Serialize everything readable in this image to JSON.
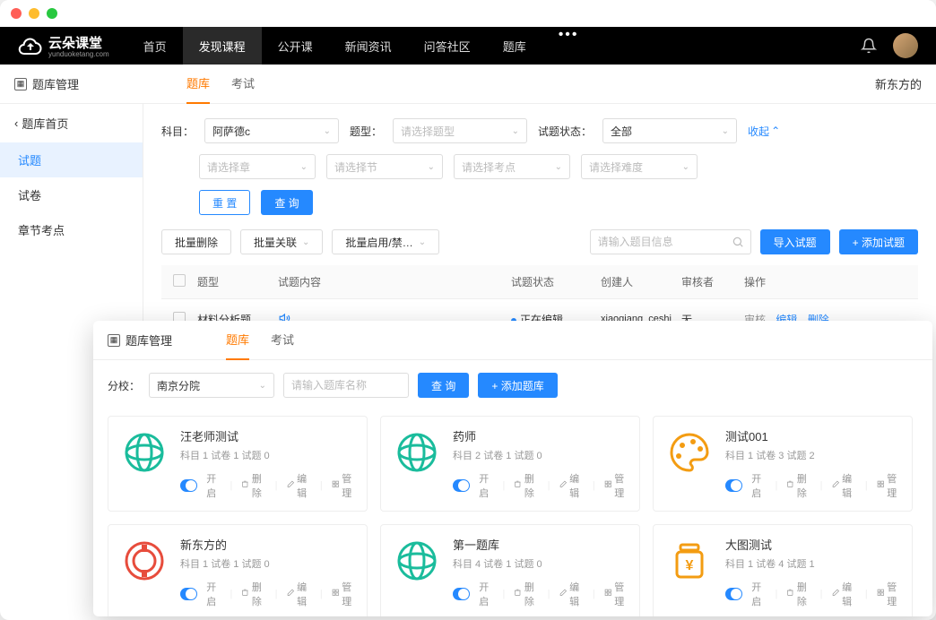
{
  "topnav": {
    "logo_text": "云朵课堂",
    "logo_sub": "yunduoketang.com",
    "items": [
      "首页",
      "发现课程",
      "公开课",
      "新闻资讯",
      "问答社区",
      "题库"
    ],
    "active_index": 1
  },
  "subheader": {
    "title": "题库管理",
    "tabs": [
      "题库",
      "考试"
    ],
    "active_tab": 0,
    "right_text": "新东方的"
  },
  "sidebar": {
    "back": "题库首页",
    "items": [
      "试题",
      "试卷",
      "章节考点"
    ],
    "active_index": 0
  },
  "filters": {
    "subject_label": "科目：",
    "subject_value": "阿萨德c",
    "type_label": "题型：",
    "type_placeholder": "请选择题型",
    "status_label": "试题状态：",
    "status_value": "全部",
    "collapse": "收起",
    "chapter_placeholder": "请选择章",
    "section_placeholder": "请选择节",
    "point_placeholder": "请选择考点",
    "difficulty_placeholder": "请选择难度",
    "reset_btn": "重 置",
    "query_btn": "查 询"
  },
  "actions": {
    "batch_delete": "批量删除",
    "batch_link": "批量关联",
    "batch_enable": "批量启用/禁…",
    "search_placeholder": "请输入题目信息",
    "import_btn": "导入试题",
    "add_btn": "+ 添加试题"
  },
  "table": {
    "headers": {
      "type": "题型",
      "content": "试题内容",
      "status": "试题状态",
      "creator": "创建人",
      "reviewer": "审核者",
      "ops": "操作"
    },
    "rows": [
      {
        "type": "材料分析题",
        "content_icon": "audio",
        "status": "正在编辑",
        "creator": "xiaoqiang_ceshi",
        "reviewer": "无",
        "ops": {
          "review": "审核",
          "edit": "编辑",
          "delete": "删除"
        }
      }
    ]
  },
  "overlay": {
    "title": "题库管理",
    "tabs": [
      "题库",
      "考试"
    ],
    "active_tab": 0,
    "branch_label": "分校：",
    "branch_value": "南京分院",
    "name_placeholder": "请输入题库名称",
    "query_btn": "查 询",
    "add_btn": "+ 添加题库",
    "card_ops": {
      "open": "开启",
      "delete": "删除",
      "edit": "编辑",
      "manage": "管理"
    },
    "cards": [
      {
        "title": "汪老师测试",
        "meta": "科目 1  试卷 1  试题 0",
        "icon": "globe-green"
      },
      {
        "title": "药师",
        "meta": "科目 2  试卷 1  试题 0",
        "icon": "globe-green"
      },
      {
        "title": "测试001",
        "meta": "科目 1  试卷 3  试题 2",
        "icon": "palette-orange"
      },
      {
        "title": "新东方的",
        "meta": "科目 1  试卷 1  试题 0",
        "icon": "coin-red"
      },
      {
        "title": "第一题库",
        "meta": "科目 4  试卷 1  试题 0",
        "icon": "globe-green"
      },
      {
        "title": "大图测试",
        "meta": "科目 1  试卷 4  试题 1",
        "icon": "jar-orange"
      }
    ]
  }
}
